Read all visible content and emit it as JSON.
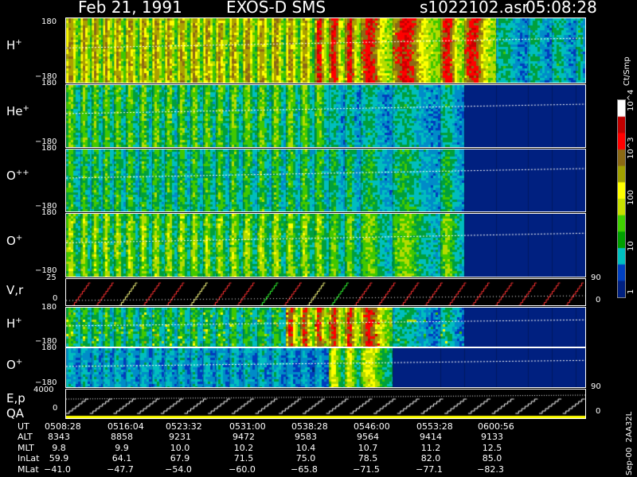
{
  "header": {
    "date": "Feb 21, 1991",
    "instrument": "EXOS-D SMS",
    "file": "s1022102.asr",
    "time": "05:08:28"
  },
  "colorbar": {
    "unit": "Ct/Smp",
    "ticks": [
      "10^4",
      "10^3",
      "100",
      "10",
      "1"
    ],
    "colors": [
      "#ffffff",
      "#c00000",
      "#ff0000",
      "#8b6914",
      "#a0a000",
      "#ffff00",
      "#c8e000",
      "#40d000",
      "#00a000",
      "#00c0c0",
      "#0040c0",
      "#002080"
    ]
  },
  "panels": {
    "h_plus": {
      "label": "H",
      "sup": "+",
      "ytop": "180",
      "ybot": "−180"
    },
    "he_plus": {
      "label": "He",
      "sup": "+",
      "ytop": "180",
      "ybot": "−180"
    },
    "o_pp": {
      "label": "O",
      "sup": "++",
      "ytop": "180",
      "ybot": "−180"
    },
    "o_plus": {
      "label": "O",
      "sup": "+",
      "ytop": "180",
      "ybot": "−180"
    },
    "vr": {
      "label": "V,r",
      "ytop": "25",
      "ybot": "0",
      "right_top": "90",
      "right_bot": "0"
    },
    "h_plus2": {
      "label": "H",
      "sup": "+",
      "ytop": "180",
      "ybot": "−180"
    },
    "o_plus2": {
      "label": "O",
      "sup": "+",
      "ytop": "180",
      "ybot": "−180"
    },
    "ep": {
      "label1": "E,p",
      "label2": "QA",
      "ytop": "4000",
      "ybot": "0",
      "right_top": "90",
      "right_bot": "0"
    }
  },
  "side_label": "Sep-00  2AA32L",
  "table": {
    "row_labels": [
      "UT",
      "ALT",
      "MLT",
      "InLat",
      "MLat"
    ],
    "columns": [
      {
        "UT": "0508:28",
        "ALT": "8343",
        "MLT": "9.8",
        "InLat": "59.9",
        "MLat": "−41.0"
      },
      {
        "UT": "0516:04",
        "ALT": "8858",
        "MLT": "9.9",
        "InLat": "64.1",
        "MLat": "−47.7"
      },
      {
        "UT": "0523:32",
        "ALT": "9231",
        "MLT": "10.0",
        "InLat": "67.9",
        "MLat": "−54.0"
      },
      {
        "UT": "0531:00",
        "ALT": "9472",
        "MLT": "10.2",
        "InLat": "71.5",
        "MLat": "−60.0"
      },
      {
        "UT": "0538:28",
        "ALT": "9583",
        "MLT": "10.4",
        "InLat": "75.0",
        "MLat": "−65.8"
      },
      {
        "UT": "0546:00",
        "ALT": "9564",
        "MLT": "10.7",
        "InLat": "78.5",
        "MLat": "−71.5"
      },
      {
        "UT": "0553:28",
        "ALT": "9414",
        "MLT": "11.2",
        "InLat": "82.0",
        "MLat": "−77.1"
      },
      {
        "UT": "0600:56",
        "ALT": "9133",
        "MLT": "12.5",
        "InLat": "85.0",
        "MLat": "−82.3"
      }
    ]
  },
  "chart_data": {
    "type": "heatmap",
    "title": "Feb 21, 1991   EXOS-D SMS",
    "x_labels": [
      "0508:28",
      "0516:04",
      "0523:32",
      "0531:00",
      "0538:28",
      "0546:00",
      "0553:28",
      "0600:56"
    ],
    "series": [
      {
        "name": "H+",
        "ylim": [
          -180,
          180
        ]
      },
      {
        "name": "He+",
        "ylim": [
          -180,
          180
        ]
      },
      {
        "name": "O++",
        "ylim": [
          -180,
          180
        ]
      },
      {
        "name": "O+",
        "ylim": [
          -180,
          180
        ]
      },
      {
        "name": "V,r",
        "ylim": [
          0,
          25
        ]
      },
      {
        "name": "H+",
        "ylim": [
          -180,
          180
        ]
      },
      {
        "name": "O+",
        "ylim": [
          -180,
          180
        ]
      },
      {
        "name": "E,p",
        "ylim": [
          0,
          4000
        ]
      }
    ],
    "colorbar_unit": "Ct/Smp",
    "colorbar_ticks": [
      "1",
      "10",
      "100",
      "10^3",
      "10^4"
    ]
  }
}
